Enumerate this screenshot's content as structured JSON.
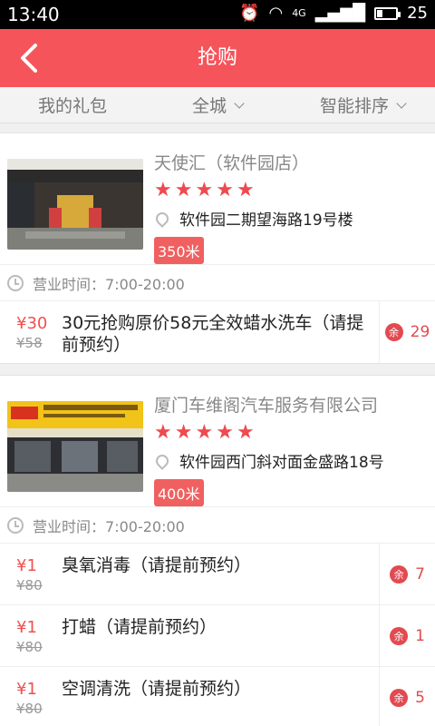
{
  "status": {
    "time": "13:40",
    "network": "4G",
    "battery": "25"
  },
  "header": {
    "title": "抢购"
  },
  "filters": [
    {
      "label": "我的礼包",
      "dropdown": false
    },
    {
      "label": "全城",
      "dropdown": true
    },
    {
      "label": "智能排序",
      "dropdown": true
    }
  ],
  "shops": [
    {
      "name": "天使汇（软件园店）",
      "rating": 5,
      "address": "软件园二期望海路19号楼",
      "distance": "350米",
      "hours_label": "营业时间：",
      "hours": "7:00-20:00",
      "deals": [
        {
          "price": "¥30",
          "original": "¥58",
          "title": "30元抢购原价58元全效蜡水洗车（请提前预约）",
          "remaining": "29"
        }
      ]
    },
    {
      "name": "厦门车维阁汽车服务有限公司",
      "rating": 5,
      "address": "软件园西门斜对面金盛路18号",
      "distance": "400米",
      "hours_label": "营业时间：",
      "hours": "7:00-20:00",
      "deals": [
        {
          "price": "¥1",
          "original": "¥80",
          "title": "臭氧消毒（请提前预约）",
          "remaining": "7"
        },
        {
          "price": "¥1",
          "original": "¥80",
          "title": "打蜡（请提前预约）",
          "remaining": "1"
        },
        {
          "price": "¥1",
          "original": "¥80",
          "title": "空调清洗（请提前预约）",
          "remaining": "5"
        }
      ]
    }
  ],
  "remain_badge": "余",
  "colors": {
    "accent": "#f5545a",
    "star": "#ee4a50",
    "price": "#f05050"
  }
}
